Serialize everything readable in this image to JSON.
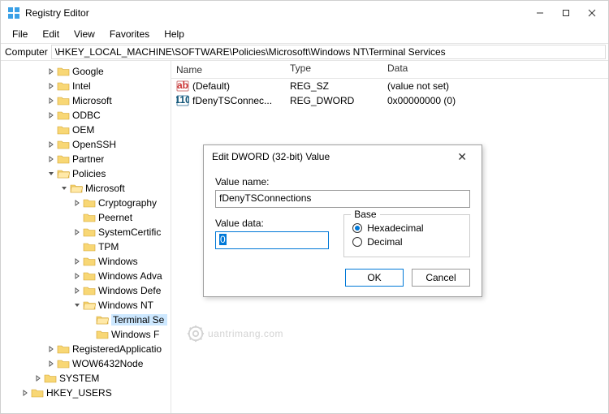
{
  "app": {
    "title": "Registry Editor"
  },
  "menu": {
    "file": "File",
    "edit": "Edit",
    "view": "View",
    "favorites": "Favorites",
    "help": "Help"
  },
  "address": {
    "label": "Computer",
    "path": "\\HKEY_LOCAL_MACHINE\\SOFTWARE\\Policies\\Microsoft\\Windows NT\\Terminal Services"
  },
  "tree": {
    "items": [
      {
        "indent": 3,
        "chevron": "right",
        "label": "Google"
      },
      {
        "indent": 3,
        "chevron": "right",
        "label": "Intel"
      },
      {
        "indent": 3,
        "chevron": "right",
        "label": "Microsoft"
      },
      {
        "indent": 3,
        "chevron": "right",
        "label": "ODBC"
      },
      {
        "indent": 3,
        "chevron": "none",
        "label": "OEM"
      },
      {
        "indent": 3,
        "chevron": "right",
        "label": "OpenSSH"
      },
      {
        "indent": 3,
        "chevron": "right",
        "label": "Partner"
      },
      {
        "indent": 3,
        "chevron": "down",
        "label": "Policies",
        "open": true
      },
      {
        "indent": 4,
        "chevron": "down",
        "label": "Microsoft",
        "open": true
      },
      {
        "indent": 5,
        "chevron": "right",
        "label": "Cryptography"
      },
      {
        "indent": 5,
        "chevron": "none",
        "label": "Peernet"
      },
      {
        "indent": 5,
        "chevron": "right",
        "label": "SystemCertific"
      },
      {
        "indent": 5,
        "chevron": "none",
        "label": "TPM"
      },
      {
        "indent": 5,
        "chevron": "right",
        "label": "Windows"
      },
      {
        "indent": 5,
        "chevron": "right",
        "label": "Windows Adva"
      },
      {
        "indent": 5,
        "chevron": "right",
        "label": "Windows Defe"
      },
      {
        "indent": 5,
        "chevron": "down",
        "label": "Windows NT",
        "open": true
      },
      {
        "indent": 6,
        "chevron": "none",
        "label": "Terminal Se",
        "selected": true
      },
      {
        "indent": 6,
        "chevron": "none",
        "label": "Windows F"
      },
      {
        "indent": 3,
        "chevron": "right",
        "label": "RegisteredApplicatio"
      },
      {
        "indent": 3,
        "chevron": "right",
        "label": "WOW6432Node"
      },
      {
        "indent": 2,
        "chevron": "right",
        "label": "SYSTEM"
      },
      {
        "indent": 1,
        "chevron": "right",
        "label": "HKEY_USERS"
      }
    ]
  },
  "list": {
    "columns": {
      "name": "Name",
      "type": "Type",
      "data": "Data"
    },
    "rows": [
      {
        "icon": "string-icon",
        "name": "(Default)",
        "type": "REG_SZ",
        "data": "(value not set)"
      },
      {
        "icon": "dword-icon",
        "name": "fDenyTSConnec...",
        "type": "REG_DWORD",
        "data": "0x00000000 (0)"
      }
    ]
  },
  "dialog": {
    "title": "Edit DWORD (32-bit) Value",
    "valueNameLabel": "Value name:",
    "valueName": "fDenyTSConnections",
    "valueDataLabel": "Value data:",
    "valueData": "0",
    "baseLabel": "Base",
    "hexLabel": "Hexadecimal",
    "decLabel": "Decimal",
    "baseSelected": "hex",
    "ok": "OK",
    "cancel": "Cancel"
  },
  "watermark": {
    "text": "uantrimang.com"
  }
}
